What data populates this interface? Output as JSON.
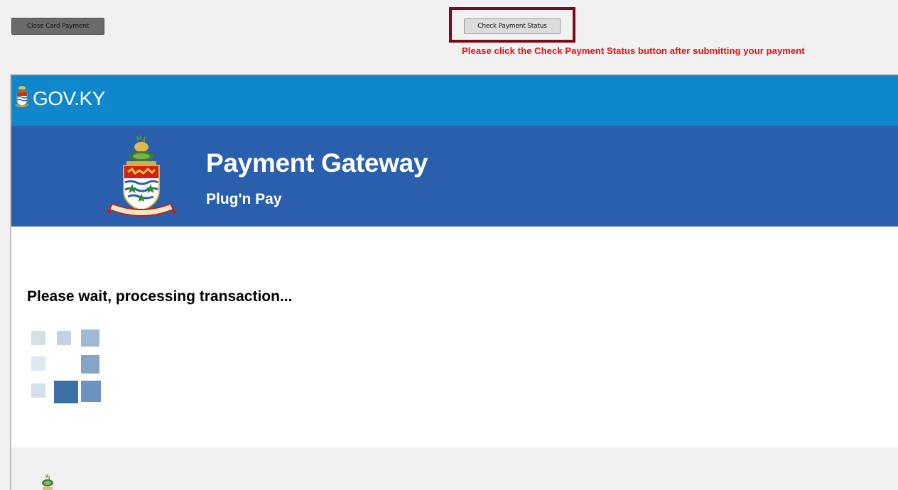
{
  "toolbar": {
    "close_label": "Close Card Payment",
    "check_status_label": "Check Payment Status",
    "status_note": "Please click the Check Payment Status button after submitting your payment"
  },
  "gov_bar": {
    "logo_text": "GOV.KY"
  },
  "banner": {
    "title": "Payment Gateway",
    "subtitle": "Plug'n Pay"
  },
  "content": {
    "processing_message": "Please wait, processing transaction..."
  },
  "colors": {
    "gov_bar_bg": "#0f87cd",
    "banner_bg": "#2a5fad",
    "alert_text": "#e81010",
    "highlight_border": "#7b0d1b"
  }
}
